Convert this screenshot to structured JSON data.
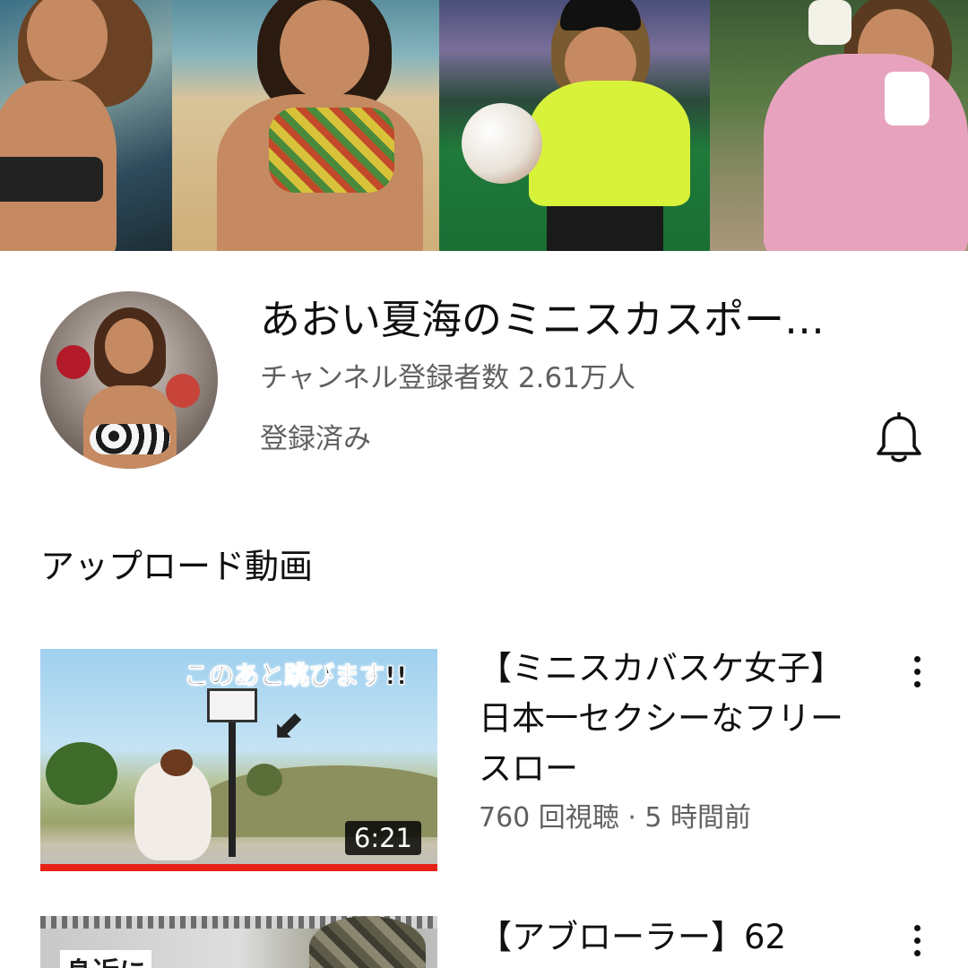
{
  "channel": {
    "name": "あおい夏海のミニスカスポー…",
    "subscribers": "チャンネル登録者数 2.61万人",
    "subscribe_state": "登録済み",
    "bell_icon": "bell-icon"
  },
  "uploads": {
    "section_title": "アップロード動画",
    "videos": [
      {
        "title": "【ミニスカバスケ女子】日本一セクシーなフリースロー",
        "meta": "760 回視聴 · 5 時間前",
        "duration": "6:21",
        "thumbnail_text": "このあと跳びます!!"
      },
      {
        "title": "【アブローラー】62",
        "thumbnail_text": "身近に"
      }
    ]
  },
  "colors": {
    "progress_bar": "#e62117",
    "secondary_text": "#606060",
    "primary_text": "#0f0f0f"
  }
}
